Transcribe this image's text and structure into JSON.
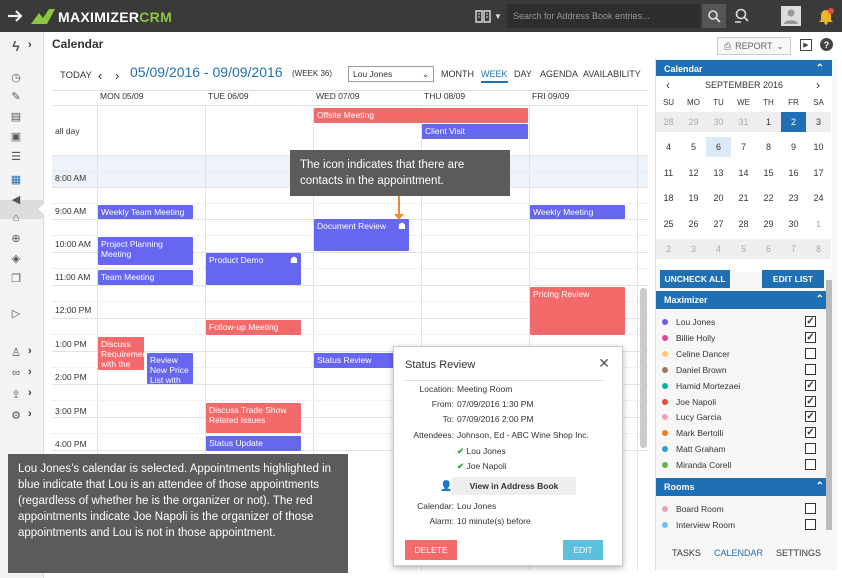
{
  "app": {
    "logo_part1": "MAXIMIZER",
    "logo_part2": "CRM"
  },
  "search": {
    "placeholder": "Search for Address Book entries..."
  },
  "page": {
    "title": "Calendar",
    "report_label": "REPORT"
  },
  "toolbar": {
    "today": "TODAY",
    "date_range": "05/09/2016 - 09/09/2016",
    "week_label": "(WEEK 36)",
    "user_selected": "Lou Jones",
    "views": [
      "MONTH",
      "WEEK",
      "DAY",
      "AGENDA",
      "AVAILABILITY"
    ],
    "active_view": "WEEK"
  },
  "grid": {
    "days": [
      "MON 05/09",
      "TUE 06/09",
      "WED 07/09",
      "THU 08/09",
      "FRI 09/09"
    ],
    "allday_label": "all day",
    "times": [
      "8:00 AM",
      "9:00 AM",
      "10:00 AM",
      "11:00 AM",
      "12:00 PM",
      "1:00 PM",
      "2:00 PM",
      "3:00 PM",
      "4:00 PM"
    ],
    "events": [
      {
        "title": "Offsite Meeting",
        "color": "red"
      },
      {
        "title": "Client Visit",
        "color": "blue"
      },
      {
        "title": "Weekly Team Meeting",
        "color": "blue"
      },
      {
        "title": "Weekly Meeting",
        "color": "blue"
      },
      {
        "title": "Document Review",
        "color": "blue",
        "has_contacts": true
      },
      {
        "title": "Project Planning Meeting",
        "color": "blue"
      },
      {
        "title": "Product Demo",
        "color": "blue",
        "has_contacts": true
      },
      {
        "title": "Team Meeting",
        "color": "blue"
      },
      {
        "title": "Pricing Review",
        "color": "red"
      },
      {
        "title": "Follow-up Meeting",
        "color": "red"
      },
      {
        "title": "Discuss Requirements with the",
        "color": "red"
      },
      {
        "title": "Review New Price List with",
        "color": "blue"
      },
      {
        "title": "Status Review",
        "color": "blue"
      },
      {
        "title": "Discuss Trade Show Related Issues",
        "color": "red"
      },
      {
        "title": "Status Update",
        "color": "blue"
      }
    ]
  },
  "popup": {
    "title": "Status Review",
    "location_label": "Location:",
    "location": "Meeting Room",
    "from_label": "From:",
    "from": "07/09/2016 1:30 PM",
    "to_label": "To:",
    "to": "07/09/2016 2:00 PM",
    "attendees_label": "Attendees:",
    "attendees": "Johnson, Ed - ABC Wine Shop Inc.",
    "attendee2": "Lou Jones",
    "attendee3": "Joe Napoli",
    "view_ab": "View in Address Book",
    "calendar_label": "Calendar:",
    "calendar": "Lou Jones",
    "alarm_label": "Alarm:",
    "alarm": "10 minute(s) before",
    "delete": "DELETE",
    "edit": "EDIT"
  },
  "callouts": {
    "icon_note": "The icon indicates that there are contacts in the appointment.",
    "main_note": "Lou Jones’s calendar is selected. Appointments highlighted in blue indicate that Lou is an attendee of those appointments (regardless of whether he is the organizer or not). The red appointments indicate Joe Napoli is the organizer of those appointments and Lou is not in those appointment."
  },
  "rightpanel": {
    "calendar_header": "Calendar",
    "month_title": "SEPTEMBER 2016",
    "dow": [
      "SU",
      "MO",
      "TU",
      "WE",
      "TH",
      "FR",
      "SA"
    ],
    "weeks": [
      [
        "28",
        "29",
        "30",
        "31",
        "1",
        "2",
        "3"
      ],
      [
        "4",
        "5",
        "6",
        "7",
        "8",
        "9",
        "10"
      ],
      [
        "11",
        "12",
        "13",
        "14",
        "15",
        "16",
        "17"
      ],
      [
        "18",
        "19",
        "20",
        "21",
        "22",
        "23",
        "24"
      ],
      [
        "25",
        "26",
        "27",
        "28",
        "29",
        "30",
        "1"
      ],
      [
        "2",
        "3",
        "4",
        "5",
        "6",
        "7",
        "8"
      ]
    ],
    "uncheck_all": "UNCHECK ALL",
    "edit_list": "EDIT LIST",
    "maximizer_header": "Maximizer",
    "users": [
      {
        "name": "Lou Jones",
        "color": "#6c5ce7",
        "checked": true
      },
      {
        "name": "Billie Holly",
        "color": "#e84393",
        "checked": true
      },
      {
        "name": "Celine Dancer",
        "color": "#fdcb6e",
        "checked": false
      },
      {
        "name": "Daniel Brown",
        "color": "#a0785a",
        "checked": false
      },
      {
        "name": "Hamid Mortezaei",
        "color": "#00b894",
        "checked": true
      },
      {
        "name": "Joe Napoli",
        "color": "#e74c3c",
        "checked": true
      },
      {
        "name": "Lucy Garcia",
        "color": "#f0a0c0",
        "checked": true
      },
      {
        "name": "Mark Bertolli",
        "color": "#e67e22",
        "checked": true
      },
      {
        "name": "Matt Graham",
        "color": "#3498db",
        "checked": false
      },
      {
        "name": "Miranda Corell",
        "color": "#6ab04c",
        "checked": false
      }
    ],
    "rooms_header": "Rooms",
    "rooms": [
      {
        "name": "Board Room",
        "color": "#f0a0c0",
        "checked": false
      },
      {
        "name": "Interview Room",
        "color": "#74b9ff",
        "checked": false
      }
    ],
    "tabs": [
      "TASKS",
      "CALENDAR",
      "SETTINGS"
    ]
  }
}
